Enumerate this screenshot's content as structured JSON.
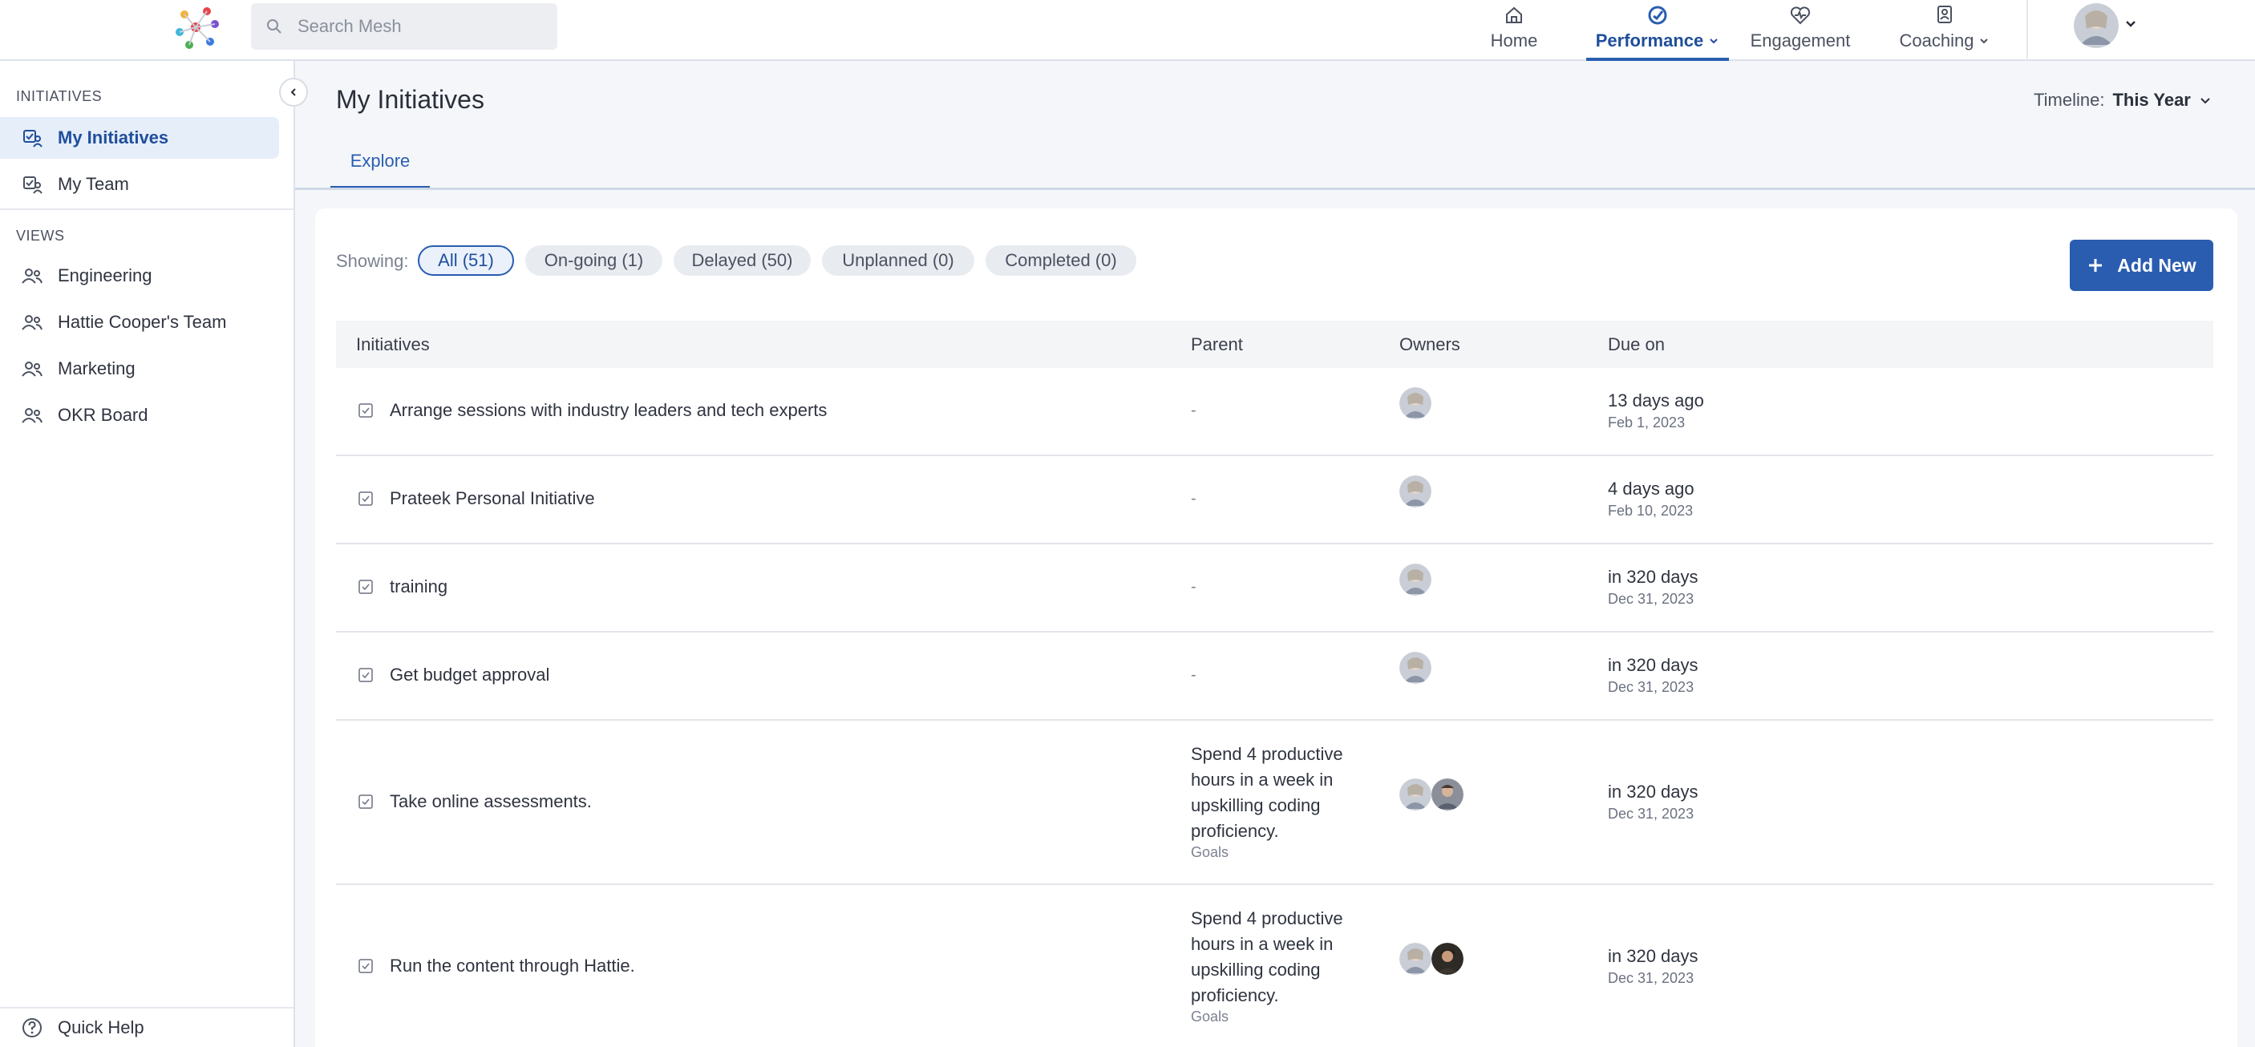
{
  "search": {
    "placeholder": "Search Mesh"
  },
  "nav": {
    "home": "Home",
    "performance": "Performance",
    "engagement": "Engagement",
    "coaching": "Coaching"
  },
  "sidebar": {
    "initiatives_title": "INITIATIVES",
    "views_title": "VIEWS",
    "items": [
      {
        "label": "My Initiatives",
        "icon": "initiatives-icon"
      },
      {
        "label": "My Team",
        "icon": "team-initiatives-icon"
      }
    ],
    "views": [
      {
        "label": "Engineering",
        "icon": "people-icon"
      },
      {
        "label": "Hattie Cooper's Team",
        "icon": "people-icon"
      },
      {
        "label": "Marketing",
        "icon": "people-icon"
      },
      {
        "label": "OKR Board",
        "icon": "people-icon"
      }
    ],
    "quick_help": "Quick Help"
  },
  "header": {
    "title": "My Initiatives",
    "timeline_label": "Timeline:",
    "timeline_value": "This Year",
    "tab": "Explore"
  },
  "filters": {
    "showing_label": "Showing:",
    "pills": [
      "All (51)",
      "On-going (1)",
      "Delayed (50)",
      "Unplanned (0)",
      "Completed (0)"
    ]
  },
  "add_button": "Add New",
  "table": {
    "columns": [
      "Initiatives",
      "Parent",
      "Owners",
      "Due on"
    ],
    "rows": [
      {
        "title": "Arrange sessions with industry leaders and tech experts",
        "parent": "-",
        "due_main": "13 days ago",
        "due_sub": "Feb 1, 2023"
      },
      {
        "title": "Prateek Personal Initiative",
        "parent": "-",
        "due_main": "4 days ago",
        "due_sub": "Feb 10, 2023"
      },
      {
        "title": "training",
        "parent": "-",
        "due_main": "in 320 days",
        "due_sub": "Dec 31, 2023"
      },
      {
        "title": "Get budget approval",
        "parent": "-",
        "due_main": "in 320 days",
        "due_sub": "Dec 31, 2023"
      },
      {
        "title": "Take online assessments.",
        "parent": "Spend 4 productive hours in a week in upskilling coding proficiency.",
        "parent_type": "Goals",
        "due_main": "in 320 days",
        "due_sub": "Dec 31, 2023"
      },
      {
        "title": "Run the content through Hattie.",
        "parent": "Spend 4 productive hours in a week in upskilling coding proficiency.",
        "parent_type": "Goals",
        "due_main": "in 320 days",
        "due_sub": "Dec 31, 2023"
      }
    ]
  },
  "colors": {
    "accent": "#2a5db0",
    "active_bg": "#e6eef9"
  }
}
